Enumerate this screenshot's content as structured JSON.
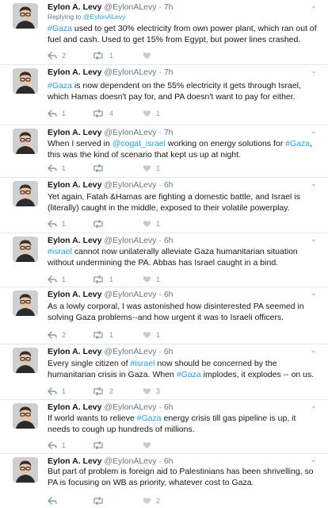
{
  "tweets": [
    {
      "name": "Eylon A. Levy",
      "handle": "@EylonALevy",
      "time": "7h",
      "reply_prefix": "Replying to ",
      "reply_handle": "@EylonALevy",
      "text": [
        {
          "t": "ht",
          "v": "#Gaza"
        },
        {
          "t": "tx",
          "v": " used to get 30% electricity from own power plant, which ran out of fuel and cash. Used to get 15% from Egypt, but power lines crashed."
        }
      ],
      "replies": "2",
      "retweets": "1",
      "likes": ""
    },
    {
      "name": "Eylon A. Levy",
      "handle": "@EylonALevy",
      "time": "7h",
      "text": [
        {
          "t": "ht",
          "v": "#Gaza"
        },
        {
          "t": "tx",
          "v": " is now dependent on the 55% electricity it gets through Israel, which Hamas doesn't pay for, and PA doesn't want to pay for either."
        }
      ],
      "replies": "1",
      "retweets": "4",
      "likes": "1"
    },
    {
      "name": "Eylon A. Levy",
      "handle": "@EylonALevy",
      "time": "7h",
      "text": [
        {
          "t": "tx",
          "v": "When I served in "
        },
        {
          "t": "mt",
          "v": "@cogat_israel"
        },
        {
          "t": "tx",
          "v": " working on energy solutions for "
        },
        {
          "t": "ht",
          "v": "#Gaza"
        },
        {
          "t": "tx",
          "v": ", this was the kind of scenario that kept us up at night."
        }
      ],
      "replies": "1",
      "retweets": "",
      "likes": "1"
    },
    {
      "name": "Eylon A. Levy",
      "handle": "@EylonALevy",
      "time": "6h",
      "text": [
        {
          "t": "tx",
          "v": "Yet again, Fatah &Hamas are fighting a domestic battle, and Israel is (literally) caught in the middle, exposed to their volatile powerplay."
        }
      ],
      "replies": "1",
      "retweets": "",
      "likes": "1"
    },
    {
      "name": "Eylon A. Levy",
      "handle": "@EylonALevy",
      "time": "6h",
      "text": [
        {
          "t": "ht",
          "v": "#israel"
        },
        {
          "t": "tx",
          "v": " cannot now unilaterally alleviate Gaza humanitarian situation without undermining the PA. Abbas has Israel caught in a bind."
        }
      ],
      "replies": "1",
      "retweets": "1",
      "likes": "1"
    },
    {
      "name": "Eylon A. Levy",
      "handle": "@EylonALevy",
      "time": "6h",
      "text": [
        {
          "t": "tx",
          "v": "As a lowly corporal, I was astonished how disinterested PA seemed in solving Gaza problems--and how urgent it was to Israeli officers."
        }
      ],
      "replies": "2",
      "retweets": "1",
      "likes": "1"
    },
    {
      "name": "Eylon A. Levy",
      "handle": "@EylonALevy",
      "time": "6h",
      "text": [
        {
          "t": "tx",
          "v": "Every single citizen of "
        },
        {
          "t": "ht",
          "v": "#israel"
        },
        {
          "t": "tx",
          "v": " now should be concerned by the humanitarian crisis in Gaza. When "
        },
        {
          "t": "ht",
          "v": "#Gaza"
        },
        {
          "t": "tx",
          "v": " implodes, it explodes -- on us."
        }
      ],
      "replies": "1",
      "retweets": "2",
      "likes": "3"
    },
    {
      "name": "Eylon A. Levy",
      "handle": "@EylonALevy",
      "time": "6h",
      "text": [
        {
          "t": "tx",
          "v": "If world wants to relieve "
        },
        {
          "t": "ht",
          "v": "#Gaza"
        },
        {
          "t": "tx",
          "v": " energy crisis till gas pipeline is up, it needs to cough up hundreds of millions."
        }
      ],
      "replies": "1",
      "retweets": "",
      "likes": ""
    },
    {
      "name": "Eylon A. Levy",
      "handle": "@EylonALevy",
      "time": "6h",
      "text": [
        {
          "t": "tx",
          "v": "But part of problem is foreign aid to Palestinians has been shrivelling, so PA is focusing on WB as priority, whatever cost to Gaza."
        }
      ],
      "replies": "",
      "retweets": "",
      "likes": "2"
    }
  ]
}
